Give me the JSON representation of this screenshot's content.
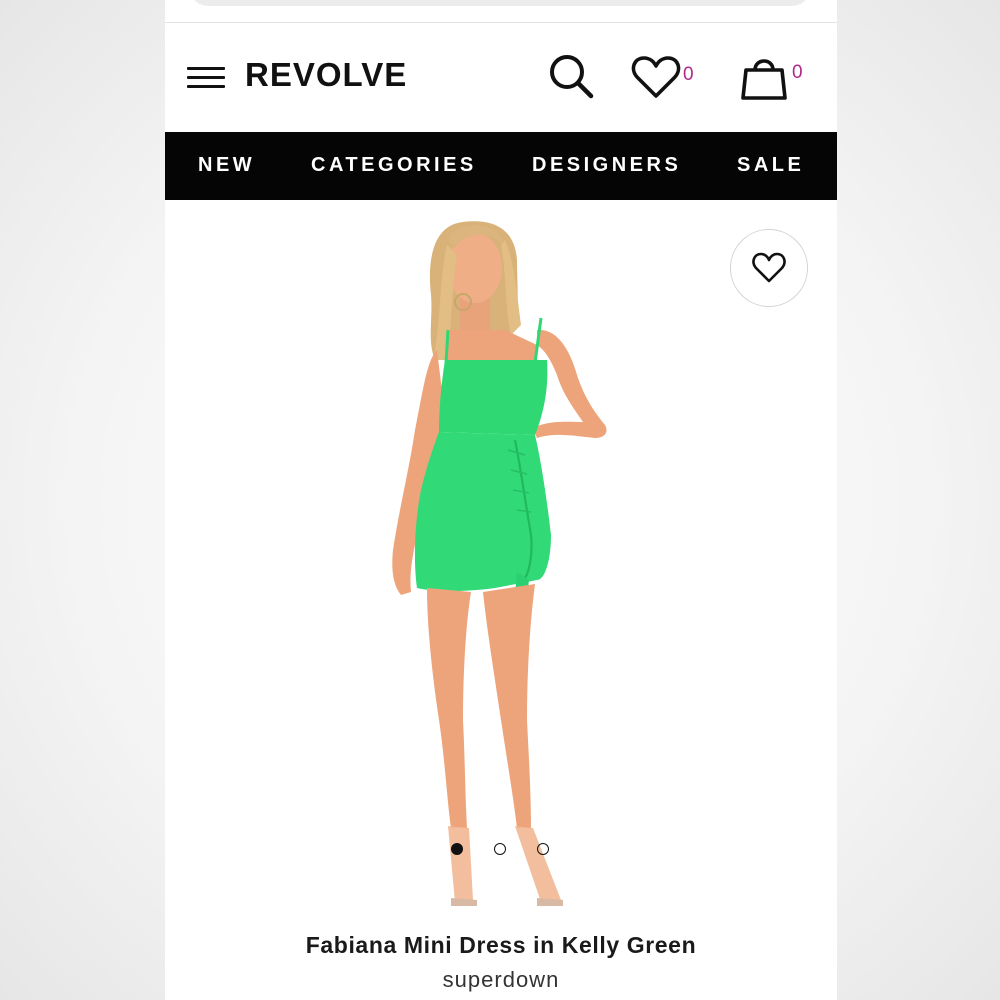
{
  "header": {
    "logo": "REVOLVE",
    "wishlist_count": "0",
    "bag_count": "0",
    "count_color": "#b0298a"
  },
  "nav": {
    "items": [
      "NEW",
      "CATEGORIES",
      "DESIGNERS",
      "SALE"
    ]
  },
  "product": {
    "title": "Fabiana Mini Dress in Kelly Green",
    "brand": "superdown",
    "dress_color": "#2fd873",
    "image_count": 3,
    "active_image": 1
  },
  "icons": {
    "menu": "hamburger-menu-icon",
    "search": "search-icon",
    "wishlist": "heart-icon",
    "bag": "shopping-bag-icon",
    "favorite": "heart-outline-icon"
  }
}
